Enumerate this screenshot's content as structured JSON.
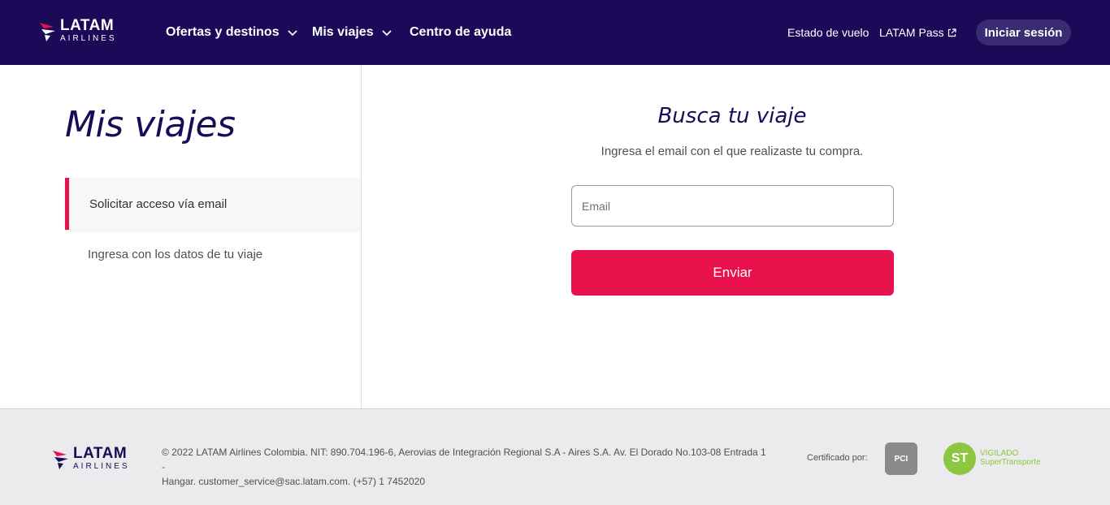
{
  "brand": {
    "logo_line1": "LATAM",
    "logo_line2": "AIRLINES",
    "colors": {
      "navy": "#1b0a58",
      "accent": "#e8114b",
      "green": "#8dc63f"
    }
  },
  "header": {
    "nav": [
      {
        "label": "Ofertas y destinos",
        "icon": "chevron-down-icon"
      },
      {
        "label": "Mis viajes",
        "icon": "chevron-down-icon"
      },
      {
        "label": "Centro de ayuda"
      }
    ],
    "links": {
      "estado": "Estado de vuelo",
      "pass": "LATAM Pass",
      "pass_icon": "external-link-icon"
    },
    "login_label": "Iniciar sesión"
  },
  "sidebar": {
    "title": "Mis viajes",
    "items": [
      {
        "label": "Solicitar acceso vía email",
        "active": true
      },
      {
        "label": "Ingresa con los datos de tu viaje",
        "active": false
      }
    ]
  },
  "form": {
    "title": "Busca tu viaje",
    "subtitle": "Ingresa el email con el que realizaste tu compra.",
    "email_placeholder": "Email",
    "email_value": "",
    "submit_label": "Enviar"
  },
  "footer": {
    "legal_line1": "© 2022 LATAM Airlines Colombia. NIT: 890.704.196-6, Aerovias de Integración Regional S.A - Aires S.A. Av. El Dorado No.103-08 Entrada 1 -",
    "legal_line2": "Hangar. customer_service@sac.latam.com. (+57) 1 7452020",
    "cert_label": "Certificado por:",
    "pci_text": "PCI",
    "st_badge_text": "ST",
    "st_line1": "VIGILADO",
    "st_line2": "SuperTransporte"
  }
}
